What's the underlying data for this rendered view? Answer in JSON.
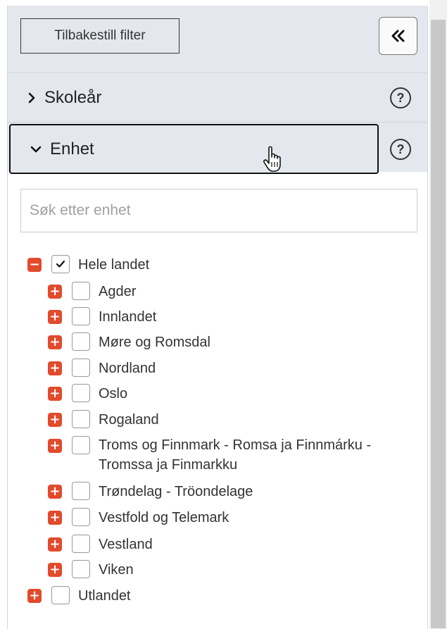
{
  "toolbar": {
    "reset_label": "Tilbakestill filter",
    "collapse_icon": "double-chevron-left-icon"
  },
  "sections": [
    {
      "title": "Skoleår",
      "expanded": false,
      "help": "?"
    },
    {
      "title": "Enhet",
      "expanded": true,
      "help": "?"
    }
  ],
  "search": {
    "placeholder": "Søk etter enhet",
    "value": ""
  },
  "tree": {
    "root": {
      "label": "Hele landet",
      "checked": true,
      "toggle": "−"
    },
    "children": [
      {
        "label": "Agder",
        "toggle": "+"
      },
      {
        "label": "Innlandet",
        "toggle": "+"
      },
      {
        "label": "Møre og Romsdal",
        "toggle": "+"
      },
      {
        "label": "Nordland",
        "toggle": "+"
      },
      {
        "label": "Oslo",
        "toggle": "+"
      },
      {
        "label": "Rogaland",
        "toggle": "+"
      },
      {
        "label": "Troms og Finnmark - Romsa ja Finnmárku - Tromssa ja Finmarkku",
        "toggle": "+"
      },
      {
        "label": "Trøndelag - Tröondelage",
        "toggle": "+"
      },
      {
        "label": "Vestfold og Telemark",
        "toggle": "+"
      },
      {
        "label": "Vestland",
        "toggle": "+"
      },
      {
        "label": "Viken",
        "toggle": "+"
      }
    ],
    "other": {
      "label": "Utlandet",
      "toggle": "+"
    }
  },
  "colors": {
    "accent": "#e24a2c",
    "panel_bg": "#e4e8ee"
  }
}
